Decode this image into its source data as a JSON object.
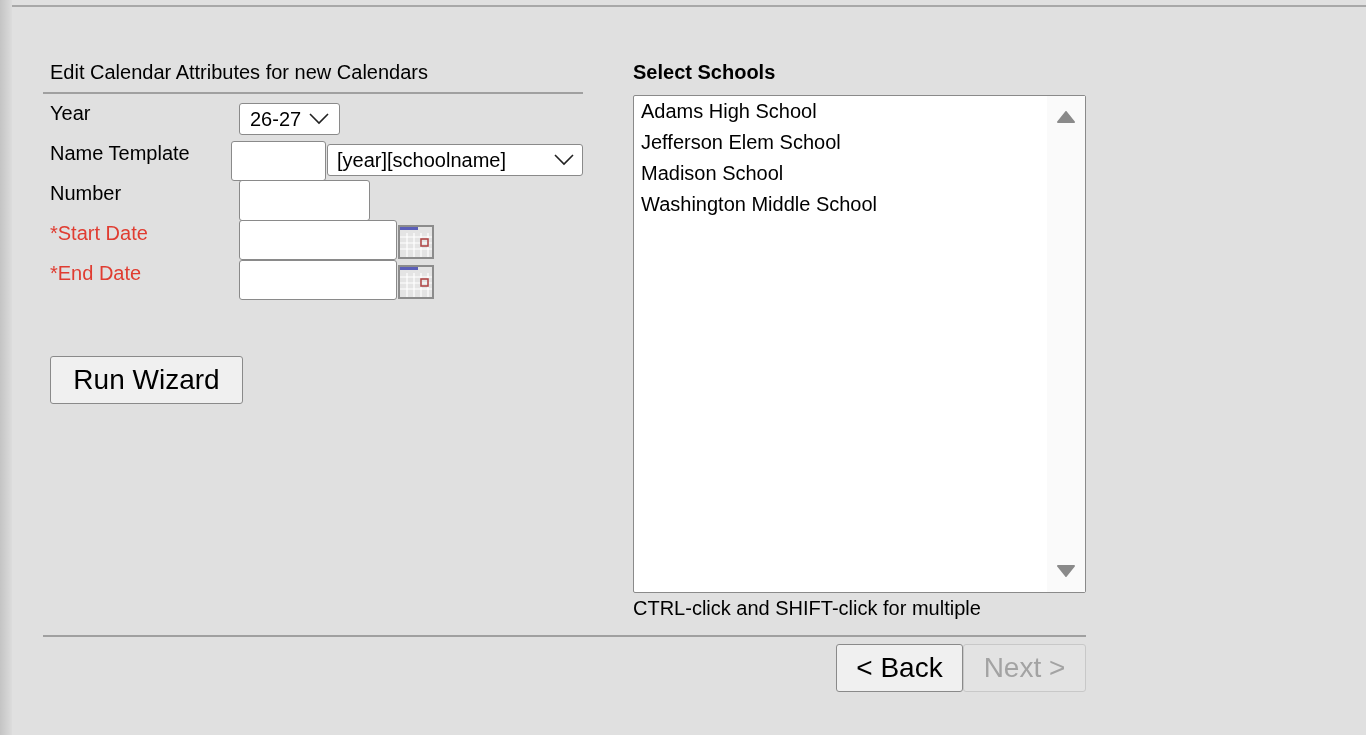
{
  "form": {
    "title": "Edit Calendar Attributes for new Calendars",
    "fields": [
      {
        "kind": "select",
        "label": "Year",
        "value": "26-27",
        "required": false
      },
      {
        "kind": "template",
        "label": "Name Template",
        "value": "[year][schoolname]",
        "required": false
      },
      {
        "kind": "text",
        "label": "Number",
        "required": false
      },
      {
        "kind": "date",
        "label": "*Start Date",
        "required": true
      },
      {
        "kind": "date",
        "label": "*End Date",
        "required": true
      }
    ],
    "run_button": "Run Wizard"
  },
  "schools": {
    "title": "Select Schools",
    "items": [
      {
        "label": "Adams High School",
        "selected": false
      },
      {
        "label": "Jefferson Elem School",
        "selected": false
      },
      {
        "label": "Madison School",
        "selected": false
      },
      {
        "label": "Washington Middle School",
        "selected": false
      }
    ],
    "hint": "CTRL-click and SHIFT-click for multiple"
  },
  "buttons": [
    {
      "label": "< Back",
      "disabled": false
    },
    {
      "label": "Next >",
      "disabled": true
    }
  ]
}
